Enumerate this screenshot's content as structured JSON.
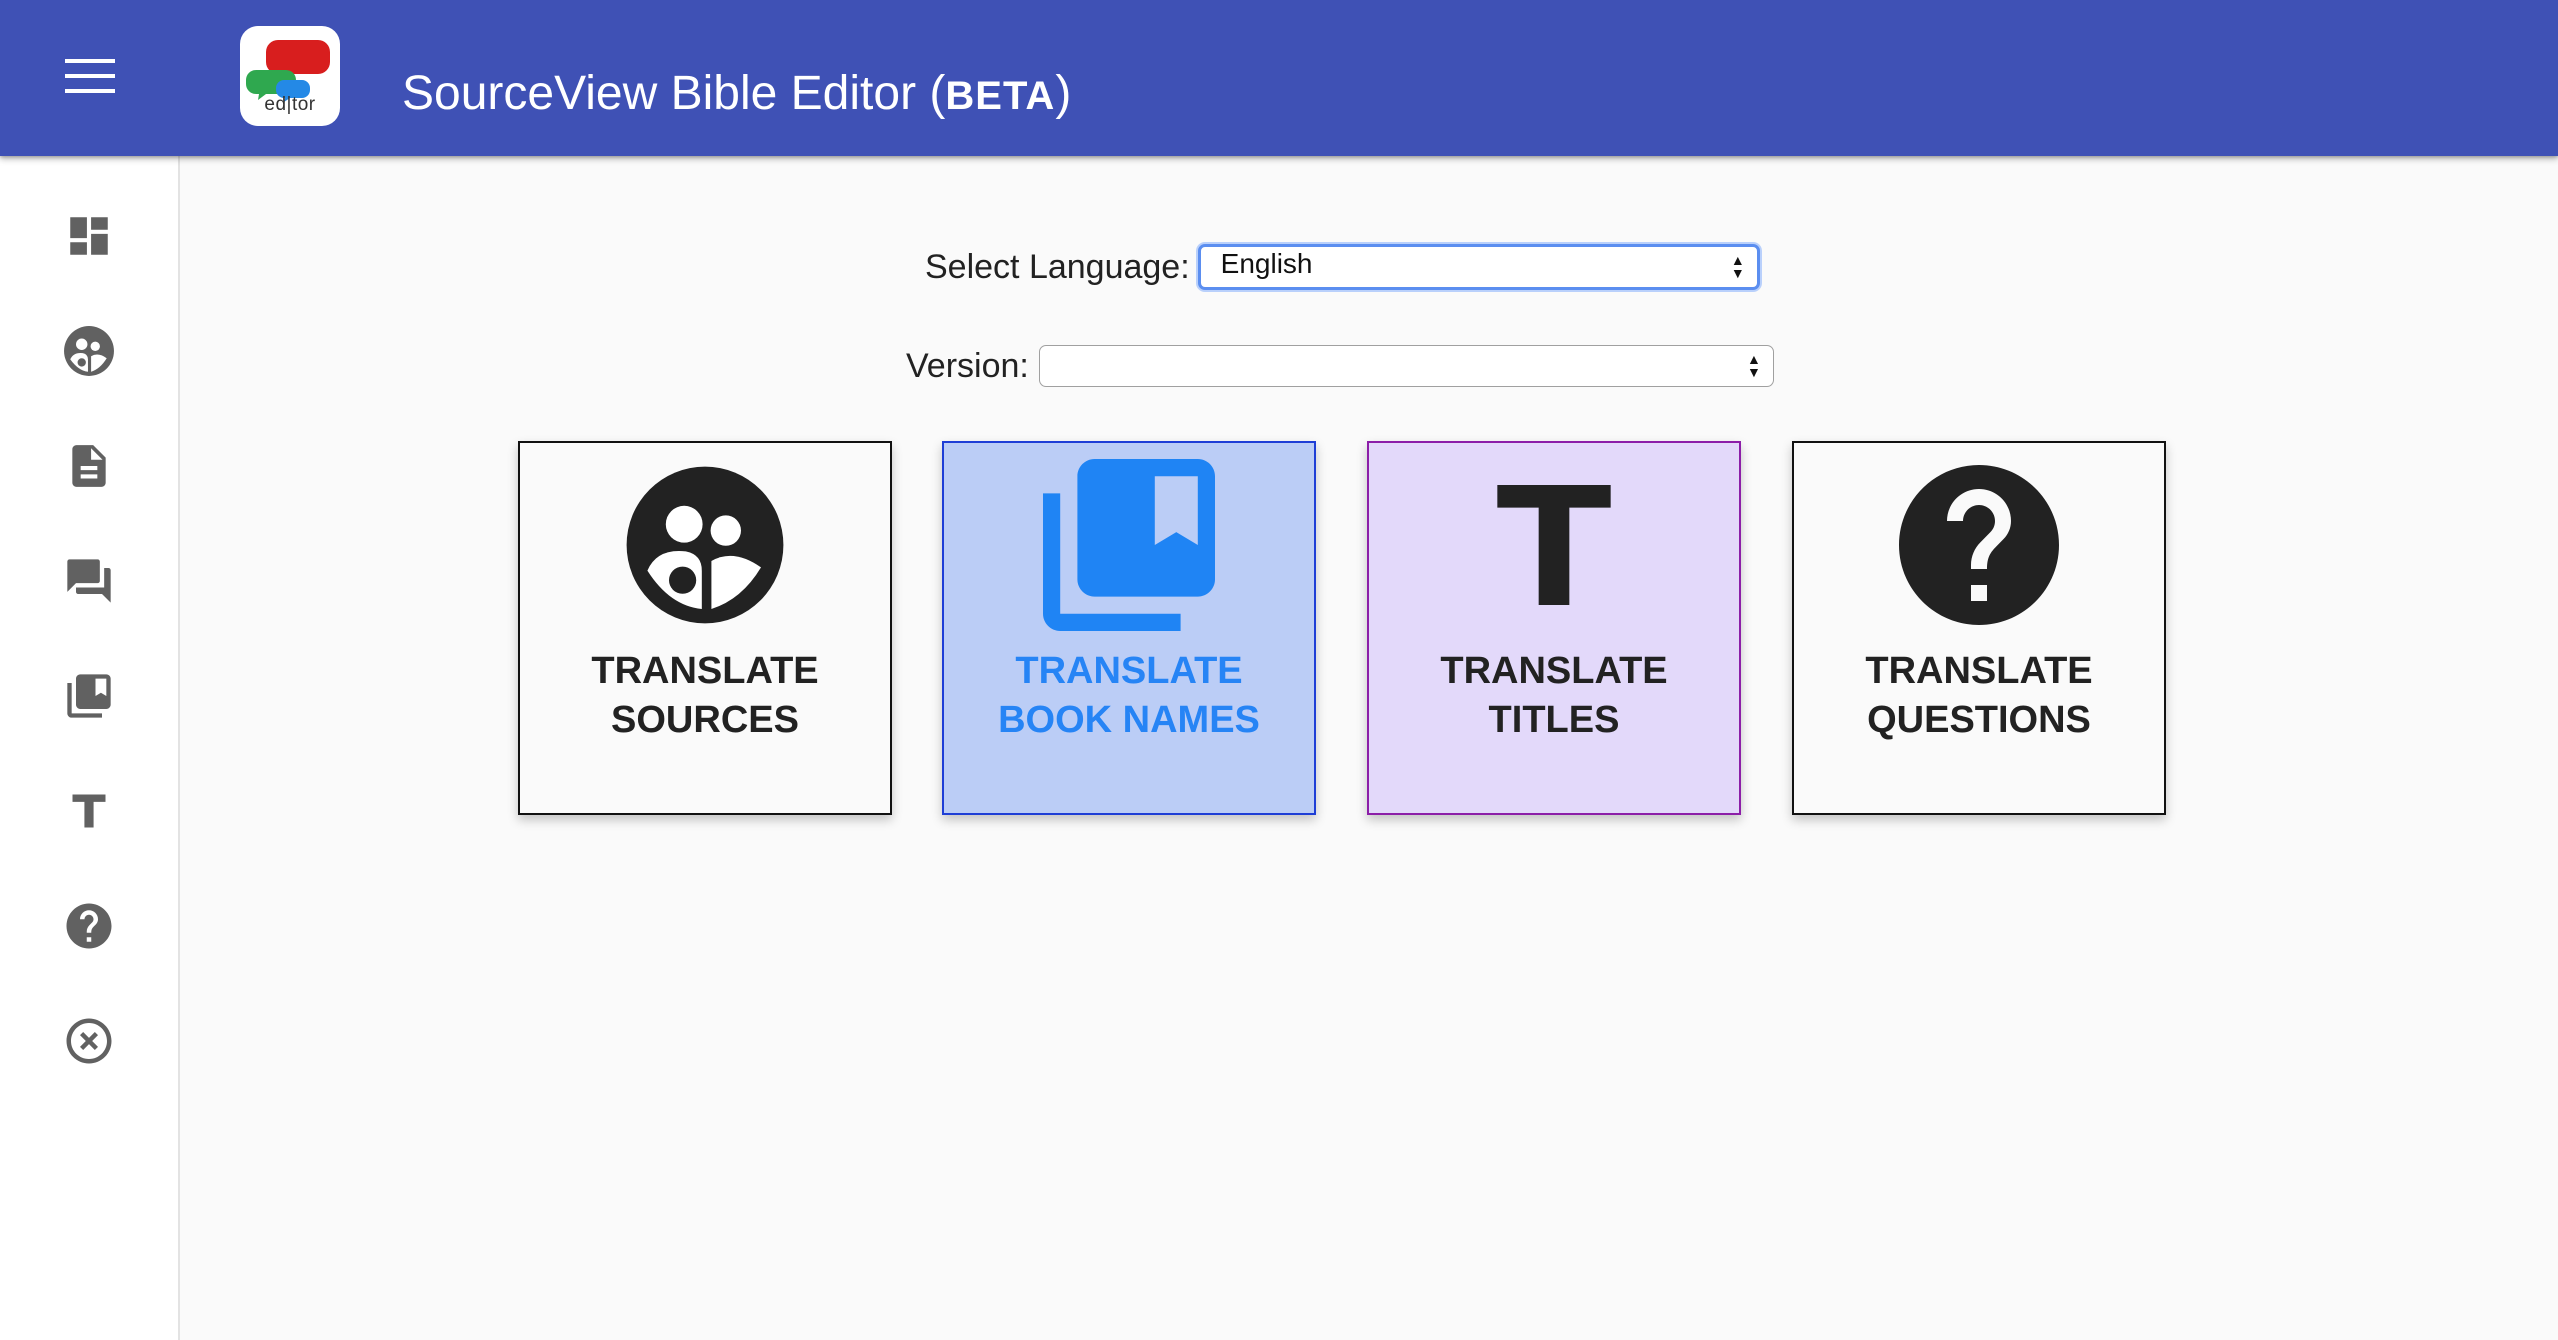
{
  "app": {
    "title": "SourceView Bible Editor",
    "beta_open": " (",
    "beta_label": "BETA",
    "beta_close": ")",
    "logo_text": "ed|tor",
    "accent_color": "#3f51b5"
  },
  "sidebar": {
    "items": [
      {
        "icon": "dashboard-icon"
      },
      {
        "icon": "translate-sources-icon"
      },
      {
        "icon": "document-icon"
      },
      {
        "icon": "forum-icon"
      },
      {
        "icon": "book-names-icon"
      },
      {
        "icon": "titles-icon"
      },
      {
        "icon": "help-icon"
      },
      {
        "icon": "close-circle-icon"
      }
    ]
  },
  "form": {
    "language_label": "Select Language:",
    "language_value": "English",
    "version_label": "Version:",
    "version_value": ""
  },
  "cards": [
    {
      "line1": "TRANSLATE",
      "line2": "SOURCES",
      "icon": "people-circle-icon",
      "background": "#fafafa",
      "border": "#111111",
      "text_color": "#222222"
    },
    {
      "line1": "TRANSLATE",
      "line2": "BOOK NAMES",
      "icon": "library-books-icon",
      "background": "#bbcdf6",
      "border": "#1e3ed6",
      "text_color": "#2684f5"
    },
    {
      "line1": "TRANSLATE",
      "line2": "TITLES",
      "icon": "title-t-icon",
      "background": "#e3d9fa",
      "border": "#8c1ea8",
      "text_color": "#222222"
    },
    {
      "line1": "TRANSLATE",
      "line2": "QUESTIONS",
      "icon": "question-circle-icon",
      "background": "#fafafa",
      "border": "#111111",
      "text_color": "#222222"
    }
  ]
}
